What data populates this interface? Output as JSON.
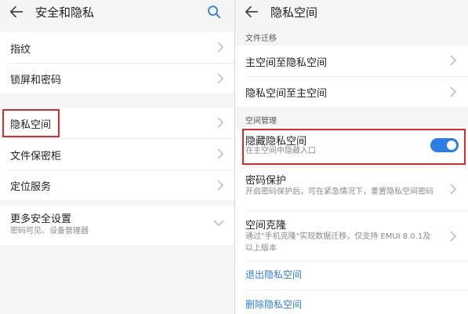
{
  "left_panel": {
    "title": "安全和隐私",
    "back_icon": "back-arrow-icon",
    "search_icon": "search-icon",
    "items": [
      {
        "label": "指纹"
      },
      {
        "label": "锁屏和密码"
      },
      {
        "label": "隐私空间"
      },
      {
        "label": "文件保密柜"
      },
      {
        "label": "定位服务"
      },
      {
        "label": "更多安全设置",
        "subtitle": "密码可见、设备管理器"
      }
    ]
  },
  "right_panel": {
    "title": "隐私空间",
    "back_icon": "back-arrow-icon",
    "section_file_migration": "文件迁移",
    "main_to_private": "主空间至隐私空间",
    "private_to_main": "隐私空间至主空间",
    "section_space_management": "空间管理",
    "hide_private_space": {
      "label": "隐藏隐私空间",
      "subtitle": "在主空间中隐藏入口",
      "toggle_state": "on"
    },
    "password_protection": {
      "label": "密码保护",
      "subtitle": "开启密码保护后，可在紧急情况下，重置隐私空间密码"
    },
    "space_clone": {
      "label": "空间克隆",
      "subtitle_line1": "通过\"手机克隆\"实现数据迁移，仅支持 EMUI 8.0.1及",
      "subtitle_line2": "以上版本"
    },
    "exit_private_space": "退出隐私空间",
    "delete_private_space": "删除隐私空间"
  },
  "colors": {
    "accent_blue": "#2a7ee5",
    "link_blue": "#2f7fd8",
    "highlight_red": "#e3262c",
    "background_gray": "#f5f5f5"
  }
}
